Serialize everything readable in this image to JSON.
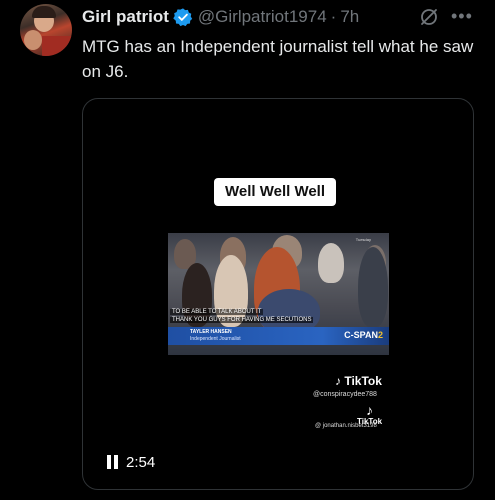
{
  "tweet": {
    "author_name": "Girl patriot",
    "handle": "@Girlpatriot1974",
    "separator": "·",
    "time": "7h",
    "text": "MTG has an Independent journalist tell what he saw on J6."
  },
  "icons": {
    "verified": "verified-badge-icon",
    "grok": "grok-icon",
    "more": "more-options-icon",
    "pause": "pause-icon"
  },
  "more_label": "•••",
  "media": {
    "caption": "Well Well Well",
    "subtitle_line1": "TO BE ABLE TO TALK ABOUT IT",
    "subtitle_line2": "THANK YOU GUYS FOR HAVING ME SECUTIONS",
    "lower_third_name": "TAYLER HANSEN",
    "lower_third_title": "Independent Journalist",
    "network_prefix": "C-SPAN",
    "network_number": "2",
    "corner_text": "Tuesday",
    "tiktok_label": "TikTok",
    "tiktok_handle_1": "@conspiracydee788",
    "tiktok_label_small": "TikTok",
    "tiktok_handle_2": "@ jonathan.nisbet3198",
    "duration": "2:54"
  },
  "colors": {
    "background": "#000000",
    "text_primary": "#e7e9ea",
    "text_secondary": "#71767b",
    "verified_blue": "#1d9bf0",
    "media_border": "#2f3336"
  }
}
